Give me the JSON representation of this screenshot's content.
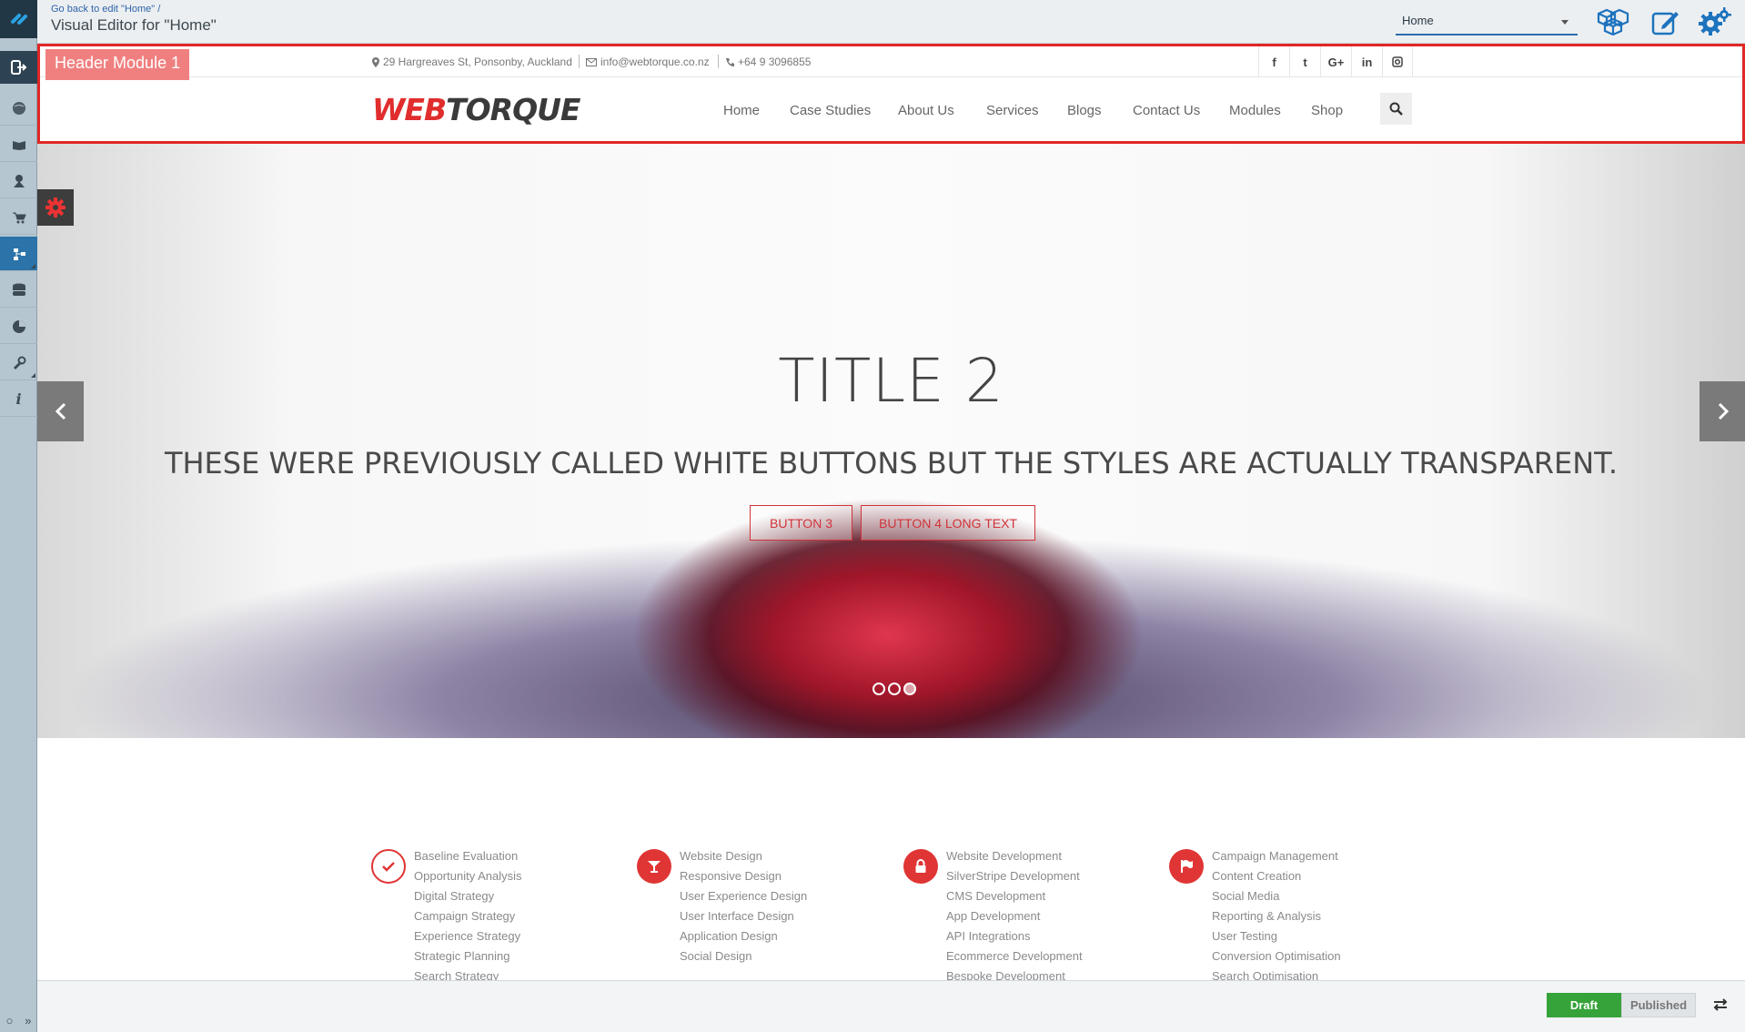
{
  "editor": {
    "back_link": "Go back to edit \"Home\" /",
    "title": "Visual Editor for \"Home\"",
    "page_select": "Home"
  },
  "rail": {
    "icons": [
      "globe-icon",
      "book-icon",
      "user-marker-icon",
      "cart-icon",
      "sitemap-icon",
      "database-icon",
      "pie-chart-icon",
      "wrench-icon",
      "info-icon"
    ],
    "active_index": 4
  },
  "header": {
    "module_label": "Header Module 1",
    "address": "29 Hargreaves St, Ponsonby, Auckland",
    "email": "info@webtorque.co.nz",
    "phone": "+64 9 3096855",
    "social": [
      "f",
      "t",
      "G+",
      "in",
      "ig"
    ],
    "logo_part1": "WEB",
    "logo_part2": "TORQUE",
    "nav": [
      "Home",
      "Case Studies",
      "About Us",
      "Services",
      "Blogs",
      "Contact Us",
      "Modules",
      "Shop"
    ]
  },
  "hero": {
    "title": "TITLE 2",
    "subtitle": "THESE WERE PREVIOUSLY CALLED WHITE BUTTONS BUT THE STYLES ARE ACTUALLY TRANSPARENT.",
    "button1": "BUTTON 3",
    "button2": "BUTTON 4 LONG TEXT",
    "slide_count": 3,
    "active_slide": 2
  },
  "services": [
    {
      "icon": "check-icon",
      "items": [
        "Baseline Evaluation",
        "Opportunity Analysis",
        "Digital Strategy",
        "Campaign Strategy",
        "Experience Strategy",
        "Strategic Planning",
        "Search Strategy"
      ]
    },
    {
      "icon": "cocktail-icon",
      "items": [
        "Website Design",
        "Responsive Design",
        "User Experience Design",
        "User Interface Design",
        "Application Design",
        "Social Design"
      ]
    },
    {
      "icon": "lock-icon",
      "items": [
        "Website Development",
        "SilverStripe Development",
        "CMS Development",
        "App Development",
        "API Integrations",
        "Ecommerce Development",
        "Bespoke Development"
      ]
    },
    {
      "icon": "flag-icon",
      "items": [
        "Campaign Management",
        "Content Creation",
        "Social Media",
        "Reporting & Analysis",
        "User Testing",
        "Conversion Optimisation",
        "Search Optimisation"
      ]
    }
  ],
  "status": {
    "draft": "Draft",
    "published": "Published"
  },
  "colors": {
    "accent": "#e03535",
    "rail": "#b6c6d0",
    "rail_dark": "#223746",
    "active_blue": "#2b73a8",
    "draft_green": "#36a33a"
  }
}
